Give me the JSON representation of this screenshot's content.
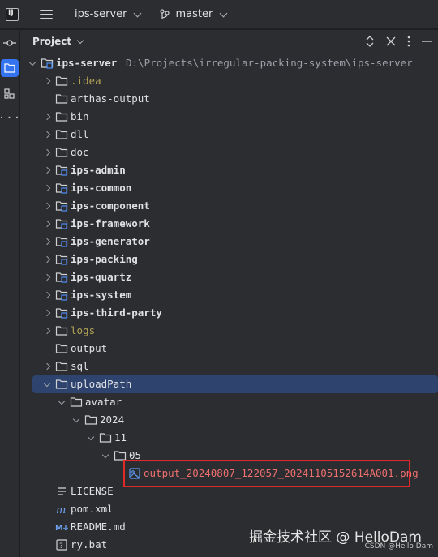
{
  "titlebar": {
    "logo_text": "IJ",
    "project_name": "ips-server",
    "branch_name": "master"
  },
  "panel": {
    "title": "Project"
  },
  "tree": [
    {
      "label": "ips-server",
      "hint": "D:\\Projects\\irregular-packing-system\\ips-server",
      "type": "module",
      "depth": 0,
      "expand": "down"
    },
    {
      "label": ".idea",
      "type": "excluded",
      "depth": 1,
      "expand": "right"
    },
    {
      "label": "arthas-output",
      "type": "folder",
      "depth": 1,
      "expand": "none"
    },
    {
      "label": "bin",
      "type": "folder",
      "depth": 1,
      "expand": "right"
    },
    {
      "label": "dll",
      "type": "folder",
      "depth": 1,
      "expand": "right"
    },
    {
      "label": "doc",
      "type": "folder",
      "depth": 1,
      "expand": "right"
    },
    {
      "label": "ips-admin",
      "type": "module",
      "depth": 1,
      "expand": "right"
    },
    {
      "label": "ips-common",
      "type": "module",
      "depth": 1,
      "expand": "right"
    },
    {
      "label": "ips-component",
      "type": "module",
      "depth": 1,
      "expand": "right"
    },
    {
      "label": "ips-framework",
      "type": "module",
      "depth": 1,
      "expand": "right"
    },
    {
      "label": "ips-generator",
      "type": "module",
      "depth": 1,
      "expand": "right"
    },
    {
      "label": "ips-packing",
      "type": "module",
      "depth": 1,
      "expand": "right"
    },
    {
      "label": "ips-quartz",
      "type": "module",
      "depth": 1,
      "expand": "right"
    },
    {
      "label": "ips-system",
      "type": "module",
      "depth": 1,
      "expand": "right"
    },
    {
      "label": "ips-third-party",
      "type": "module",
      "depth": 1,
      "expand": "right"
    },
    {
      "label": "logs",
      "type": "excluded",
      "depth": 1,
      "expand": "right"
    },
    {
      "label": "output",
      "type": "folder",
      "depth": 1,
      "expand": "none"
    },
    {
      "label": "sql",
      "type": "folder",
      "depth": 1,
      "expand": "right"
    },
    {
      "label": "uploadPath",
      "type": "folder",
      "depth": 1,
      "expand": "down",
      "selected": true
    },
    {
      "label": "avatar",
      "type": "folder",
      "depth": 2,
      "expand": "down"
    },
    {
      "label": "2024",
      "type": "folder",
      "depth": 3,
      "expand": "down"
    },
    {
      "label": "11",
      "type": "folder",
      "depth": 4,
      "expand": "down"
    },
    {
      "label": "05",
      "type": "folder",
      "depth": 5,
      "expand": "down"
    },
    {
      "label": "output_20240807_122057_20241105152614A001.png",
      "type": "png",
      "depth": 6,
      "expand": "none"
    },
    {
      "label": "LICENSE",
      "type": "license",
      "depth": 1,
      "expand": "none"
    },
    {
      "label": "pom.xml",
      "type": "maven",
      "depth": 1,
      "expand": "none"
    },
    {
      "label": "README.md",
      "type": "markdown",
      "depth": 1,
      "expand": "none"
    },
    {
      "label": "ry.bat",
      "type": "bat",
      "depth": 1,
      "expand": "none"
    }
  ],
  "watermark": "掘金技术社区 @ HelloDam",
  "credit": "CSDN @Hello Dam"
}
